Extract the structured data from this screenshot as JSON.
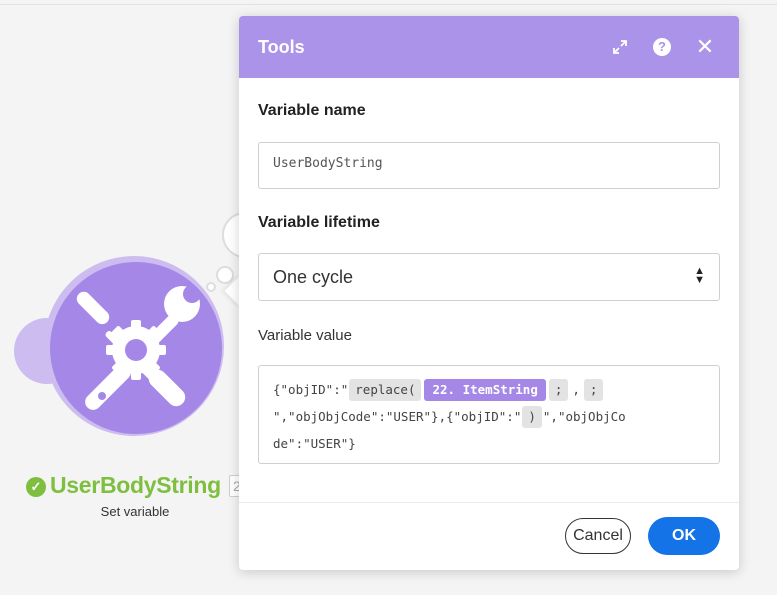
{
  "module": {
    "name": "UserBodyString",
    "id_badge": "2",
    "subtitle": "Set variable",
    "icon": "tools-icon",
    "accent": "#a487e6",
    "success_color": "#7fbf3f"
  },
  "dialog": {
    "title": "Tools",
    "header_icons": [
      "expand-icon",
      "help-icon",
      "close-icon"
    ],
    "header_color": "#ab93ea",
    "variable_name_label": "Variable name",
    "variable_name_value": "UserBodyString",
    "variable_lifetime_label": "Variable lifetime",
    "variable_lifetime_value": "One cycle",
    "variable_value_label": "Variable value",
    "value": {
      "t1": "{\"objID\":\"",
      "p1": "replace(",
      "v1": "22. ItemString",
      "p2": ";",
      "t2": ",",
      "p3": ";",
      "t3": "\",\"objObjCode\":\"USER\"},{\"objID\":\"",
      "p4": ")",
      "t4": "\",\"objObjCo",
      "t5": "de\":\"USER\"}"
    },
    "cancel_label": "Cancel",
    "ok_label": "OK",
    "ok_color": "#1473e6"
  }
}
